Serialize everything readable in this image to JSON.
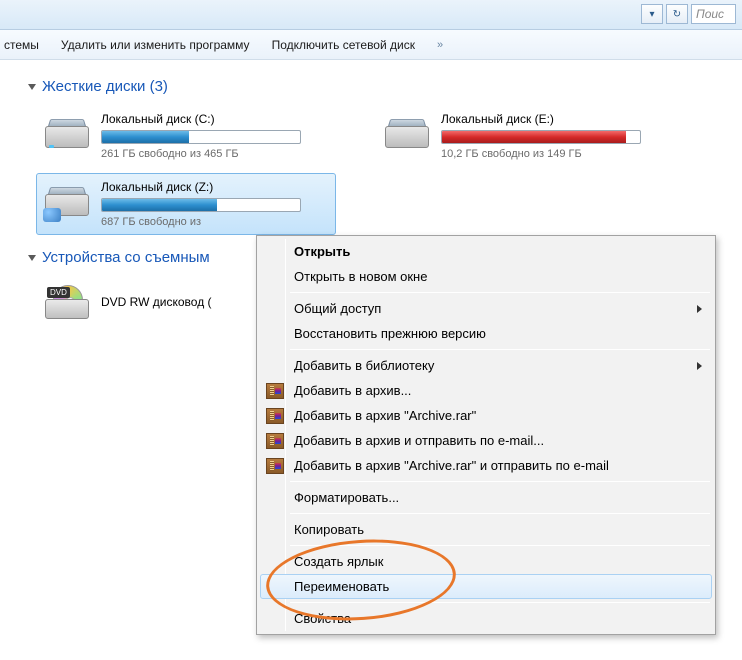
{
  "topbar": {
    "dropdown_glyph": "▾",
    "refresh_glyph": "↻",
    "search_placeholder": "Поис"
  },
  "menubar": {
    "item1": "стемы",
    "item2": "Удалить или изменить программу",
    "item3": "Подключить сетевой диск",
    "more_glyph": "»"
  },
  "section_hdd": {
    "title": "Жесткие диски (3)"
  },
  "drives": {
    "c": {
      "name": "Локальный диск (C:)",
      "free": "261 ГБ свободно из 465 ГБ",
      "fill_pct": 44
    },
    "e": {
      "name": "Локальный диск (E:)",
      "free": "10,2 ГБ свободно из 149 ГБ",
      "fill_pct": 93
    },
    "z": {
      "name": "Локальный диск (Z:)",
      "free": "687 ГБ свободно из",
      "fill_pct": 58
    }
  },
  "section_removable": {
    "title": "Устройства со съемным"
  },
  "dvd": {
    "name": "DVD RW дисковод (",
    "badge": "DVD"
  },
  "ctx": {
    "open": "Открыть",
    "open_new": "Открыть в новом окне",
    "share": "Общий доступ",
    "restore": "Восстановить прежнюю версию",
    "library": "Добавить в библиотеку",
    "rar1": "Добавить в архив...",
    "rar2": "Добавить в архив \"Archive.rar\"",
    "rar3": "Добавить в архив и отправить по e-mail...",
    "rar4": "Добавить в архив \"Archive.rar\" и отправить по e-mail",
    "format": "Форматировать...",
    "copy": "Копировать",
    "shortcut": "Создать ярлык",
    "rename": "Переименовать",
    "props": "Свойства"
  }
}
